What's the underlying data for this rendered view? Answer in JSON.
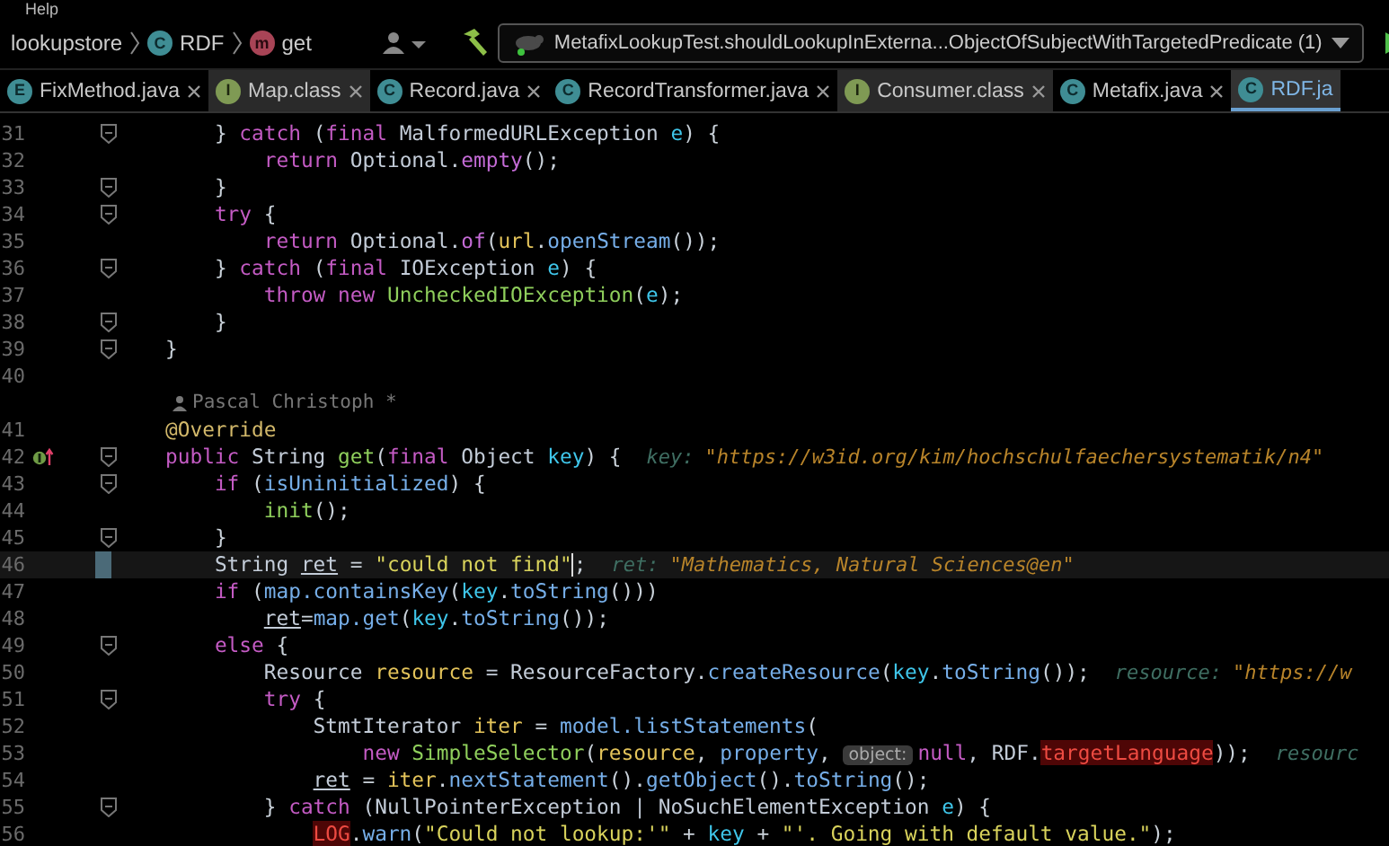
{
  "menu": [
    "Help"
  ],
  "breadcrumbs": [
    {
      "label": "lookupstore",
      "kind": "module"
    },
    {
      "label": "RDF",
      "icon": "C",
      "kind": "class"
    },
    {
      "label": "get",
      "icon": "m",
      "kind": "method"
    }
  ],
  "run_config": {
    "label": "MetafixLookupTest.shouldLookupInExterna...ObjectOfSubjectWithTargetedPredicate (1)"
  },
  "tabs": [
    {
      "label": "FixMethod.java",
      "icon": "E",
      "kind": "enum",
      "selected": false
    },
    {
      "label": "Map.class",
      "icon": "I",
      "kind": "interface",
      "selected": false
    },
    {
      "label": "Record.java",
      "icon": "C",
      "kind": "class",
      "selected": false
    },
    {
      "label": "RecordTransformer.java",
      "icon": "C",
      "kind": "class",
      "selected": false
    },
    {
      "label": "Consumer.class",
      "icon": "I",
      "kind": "interface",
      "selected": false
    },
    {
      "label": "Metafix.java",
      "icon": "C",
      "kind": "class",
      "selected": false
    },
    {
      "label": "RDF.ja",
      "icon": "C",
      "kind": "class",
      "selected": true
    }
  ],
  "lines": [
    {
      "kind": "code",
      "number": "31",
      "fold": true,
      "current": false,
      "overrides": false,
      "tokens": [
        {
          "text": "    } ",
          "kind": "plain"
        },
        {
          "text": "catch",
          "kind": "keyword"
        },
        {
          "text": " (",
          "kind": "plain"
        },
        {
          "text": "final",
          "kind": "keyword"
        },
        {
          "text": " MalformedURLException ",
          "kind": "type"
        },
        {
          "text": "e",
          "kind": "param"
        },
        {
          "text": ") {",
          "kind": "plain"
        }
      ]
    },
    {
      "kind": "code",
      "number": "32",
      "fold": false,
      "current": false,
      "overrides": false,
      "tokens": [
        {
          "text": "        return",
          "kind": "keyword"
        },
        {
          "text": " Optional.",
          "kind": "type"
        },
        {
          "text": "empty",
          "kind": "method"
        },
        {
          "text": "();",
          "kind": "plain"
        }
      ]
    },
    {
      "kind": "code",
      "number": "33",
      "fold": true,
      "current": false,
      "overrides": false,
      "tokens": [
        {
          "text": "    }",
          "kind": "plain"
        }
      ]
    },
    {
      "kind": "code",
      "number": "34",
      "fold": true,
      "current": false,
      "overrides": false,
      "tokens": [
        {
          "text": "    try",
          "kind": "keyword"
        },
        {
          "text": " {",
          "kind": "plain"
        }
      ]
    },
    {
      "kind": "code",
      "number": "35",
      "fold": false,
      "current": false,
      "overrides": false,
      "tokens": [
        {
          "text": "        return",
          "kind": "keyword"
        },
        {
          "text": " Optional.",
          "kind": "type"
        },
        {
          "text": "of",
          "kind": "method"
        },
        {
          "text": "(",
          "kind": "plain"
        },
        {
          "text": "url",
          "kind": "local"
        },
        {
          "text": ".",
          "kind": "plain"
        },
        {
          "text": "openStream",
          "kind": "field"
        },
        {
          "text": "());",
          "kind": "plain"
        }
      ]
    },
    {
      "kind": "code",
      "number": "36",
      "fold": true,
      "current": false,
      "overrides": false,
      "tokens": [
        {
          "text": "    } ",
          "kind": "plain"
        },
        {
          "text": "catch",
          "kind": "keyword"
        },
        {
          "text": " (",
          "kind": "plain"
        },
        {
          "text": "final",
          "kind": "keyword"
        },
        {
          "text": " IOException ",
          "kind": "type"
        },
        {
          "text": "e",
          "kind": "param"
        },
        {
          "text": ") {",
          "kind": "plain"
        }
      ]
    },
    {
      "kind": "code",
      "number": "37",
      "fold": false,
      "current": false,
      "overrides": false,
      "tokens": [
        {
          "text": "        throw new",
          "kind": "keyword"
        },
        {
          "text": " UncheckedIOException",
          "kind": "new"
        },
        {
          "text": "(",
          "kind": "plain"
        },
        {
          "text": "e",
          "kind": "param"
        },
        {
          "text": ");",
          "kind": "plain"
        }
      ]
    },
    {
      "kind": "code",
      "number": "38",
      "fold": true,
      "current": false,
      "overrides": false,
      "tokens": [
        {
          "text": "    }",
          "kind": "plain"
        }
      ]
    },
    {
      "kind": "code",
      "number": "39",
      "fold": true,
      "current": false,
      "overrides": false,
      "tokens": [
        {
          "text": "}",
          "kind": "plain"
        }
      ]
    },
    {
      "kind": "code",
      "number": "40",
      "fold": false,
      "current": false,
      "overrides": false
    },
    {
      "kind": "author",
      "text": "Pascal Christoph *"
    },
    {
      "kind": "code",
      "number": "41",
      "fold": false,
      "current": false,
      "overrides": false,
      "tokens": [
        {
          "text": "@Override",
          "kind": "annotation"
        }
      ]
    },
    {
      "kind": "code",
      "number": "42",
      "fold": true,
      "current": false,
      "overrides": true,
      "tokens": [
        {
          "text": "public",
          "kind": "keyword"
        },
        {
          "text": " String ",
          "kind": "type"
        },
        {
          "text": "get",
          "kind": "new"
        },
        {
          "text": "(",
          "kind": "plain"
        },
        {
          "text": "final",
          "kind": "keyword"
        },
        {
          "text": " Object ",
          "kind": "type"
        },
        {
          "text": "key",
          "kind": "param"
        },
        {
          "text": ") {",
          "kind": "plain"
        },
        {
          "text": "key:",
          "kind": "hint-name"
        },
        {
          "text": "\"https://w3id.org/kim/hochschulfaechersystematik/n4\"",
          "kind": "hint-value"
        }
      ]
    },
    {
      "kind": "code",
      "number": "43",
      "fold": true,
      "current": false,
      "overrides": false,
      "tokens": [
        {
          "text": "    if",
          "kind": "keyword"
        },
        {
          "text": " (",
          "kind": "plain"
        },
        {
          "text": "isUninitialized",
          "kind": "field"
        },
        {
          "text": ") {",
          "kind": "plain"
        }
      ]
    },
    {
      "kind": "code",
      "number": "44",
      "fold": false,
      "current": false,
      "overrides": false,
      "tokens": [
        {
          "text": "        init",
          "kind": "new"
        },
        {
          "text": "();",
          "kind": "plain"
        }
      ]
    },
    {
      "kind": "code",
      "number": "45",
      "fold": true,
      "current": false,
      "overrides": false,
      "tokens": [
        {
          "text": "    }",
          "kind": "plain"
        }
      ]
    },
    {
      "kind": "code",
      "number": "46",
      "fold": false,
      "current": true,
      "overrides": false,
      "tokens": [
        {
          "text": "    String ",
          "kind": "type"
        },
        {
          "text": "ret",
          "kind": "reassigned"
        },
        {
          "text": " = ",
          "kind": "plain"
        },
        {
          "text": "\"could not find\"",
          "kind": "string"
        },
        {
          "text": ";",
          "kind": "plain"
        },
        {
          "text": "ret:",
          "kind": "hint-name"
        },
        {
          "text": "\"Mathematics, Natural Sciences@en\"",
          "kind": "hint-value"
        }
      ]
    },
    {
      "kind": "code",
      "number": "47",
      "fold": false,
      "current": false,
      "overrides": false,
      "tokens": [
        {
          "text": "    if",
          "kind": "keyword"
        },
        {
          "text": " (",
          "kind": "plain"
        },
        {
          "text": "map.containsKey",
          "kind": "field"
        },
        {
          "text": "(",
          "kind": "plain"
        },
        {
          "text": "key",
          "kind": "param"
        },
        {
          "text": ".",
          "kind": "plain"
        },
        {
          "text": "toString",
          "kind": "field"
        },
        {
          "text": "()))",
          "kind": "plain"
        }
      ]
    },
    {
      "kind": "code",
      "number": "48",
      "fold": false,
      "current": false,
      "overrides": false,
      "tokens": [
        {
          "text": "        ret",
          "kind": "reassigned"
        },
        {
          "text": "=",
          "kind": "plain"
        },
        {
          "text": "map.get",
          "kind": "field"
        },
        {
          "text": "(",
          "kind": "plain"
        },
        {
          "text": "key",
          "kind": "param"
        },
        {
          "text": ".",
          "kind": "plain"
        },
        {
          "text": "toString",
          "kind": "field"
        },
        {
          "text": "());",
          "kind": "plain"
        }
      ]
    },
    {
      "kind": "code",
      "number": "49",
      "fold": true,
      "current": false,
      "overrides": false,
      "tokens": [
        {
          "text": "    else",
          "kind": "keyword"
        },
        {
          "text": " {",
          "kind": "plain"
        }
      ]
    },
    {
      "kind": "code",
      "number": "50",
      "fold": false,
      "current": false,
      "overrides": false,
      "tokens": [
        {
          "text": "        Resource ",
          "kind": "type"
        },
        {
          "text": "resource",
          "kind": "local"
        },
        {
          "text": " = ResourceFactory.",
          "kind": "type"
        },
        {
          "text": "createResource",
          "kind": "field"
        },
        {
          "text": "(",
          "kind": "plain"
        },
        {
          "text": "key",
          "kind": "param"
        },
        {
          "text": ".",
          "kind": "plain"
        },
        {
          "text": "toString",
          "kind": "field"
        },
        {
          "text": "());",
          "kind": "plain"
        },
        {
          "text": "resource:",
          "kind": "hint-name"
        },
        {
          "text": "\"https://w",
          "kind": "hint-value"
        }
      ]
    },
    {
      "kind": "code",
      "number": "51",
      "fold": true,
      "current": false,
      "overrides": false,
      "tokens": [
        {
          "text": "        try",
          "kind": "keyword"
        },
        {
          "text": " {",
          "kind": "plain"
        }
      ]
    },
    {
      "kind": "code",
      "number": "52",
      "fold": false,
      "current": false,
      "overrides": false,
      "tokens": [
        {
          "text": "            StmtIterator ",
          "kind": "type"
        },
        {
          "text": "iter",
          "kind": "local"
        },
        {
          "text": " = ",
          "kind": "plain"
        },
        {
          "text": "model.listStatements",
          "kind": "field"
        },
        {
          "text": "(",
          "kind": "plain"
        }
      ]
    },
    {
      "kind": "code",
      "number": "53",
      "fold": false,
      "current": false,
      "overrides": false,
      "tokens": [
        {
          "text": "                new",
          "kind": "keyword"
        },
        {
          "text": " SimpleSelector",
          "kind": "new"
        },
        {
          "text": "(",
          "kind": "plain"
        },
        {
          "text": "resource",
          "kind": "local"
        },
        {
          "text": ", ",
          "kind": "plain"
        },
        {
          "text": "property",
          "kind": "field"
        },
        {
          "text": ", ",
          "kind": "plain"
        },
        {
          "text": "object:",
          "kind": "inlay"
        },
        {
          "text": "null",
          "kind": "keyword"
        },
        {
          "text": ", RDF.",
          "kind": "type"
        },
        {
          "text": "targetLanguage",
          "kind": "error"
        },
        {
          "text": "));",
          "kind": "plain"
        },
        {
          "text": "resourc",
          "kind": "hint-name"
        }
      ]
    },
    {
      "kind": "code",
      "number": "54",
      "fold": false,
      "current": false,
      "overrides": false,
      "tokens": [
        {
          "text": "            ret",
          "kind": "reassigned"
        },
        {
          "text": " = ",
          "kind": "plain"
        },
        {
          "text": "iter",
          "kind": "local"
        },
        {
          "text": ".",
          "kind": "plain"
        },
        {
          "text": "nextStatement",
          "kind": "field"
        },
        {
          "text": "().",
          "kind": "plain"
        },
        {
          "text": "getObject",
          "kind": "field"
        },
        {
          "text": "().",
          "kind": "plain"
        },
        {
          "text": "toString",
          "kind": "field"
        },
        {
          "text": "();",
          "kind": "plain"
        }
      ]
    },
    {
      "kind": "code",
      "number": "55",
      "fold": true,
      "current": false,
      "overrides": false,
      "tokens": [
        {
          "text": "        } ",
          "kind": "plain"
        },
        {
          "text": "catch",
          "kind": "keyword"
        },
        {
          "text": " (NullPointerException | NoSuchElementException ",
          "kind": "type"
        },
        {
          "text": "e",
          "kind": "param"
        },
        {
          "text": ") {",
          "kind": "plain"
        }
      ]
    },
    {
      "kind": "code",
      "number": "56",
      "fold": false,
      "current": false,
      "overrides": false,
      "tokens": [
        {
          "text": "            LOG",
          "kind": "error"
        },
        {
          "text": ".",
          "kind": "plain"
        },
        {
          "text": "warn",
          "kind": "field"
        },
        {
          "text": "(",
          "kind": "plain"
        },
        {
          "text": "\"Could not lookup:'\"",
          "kind": "string"
        },
        {
          "text": " + ",
          "kind": "plain"
        },
        {
          "text": "key",
          "kind": "param"
        },
        {
          "text": " + ",
          "kind": "plain"
        },
        {
          "text": "\"'. Going with default value.\"",
          "kind": "string"
        },
        {
          "text": ");",
          "kind": "plain"
        }
      ]
    }
  ]
}
